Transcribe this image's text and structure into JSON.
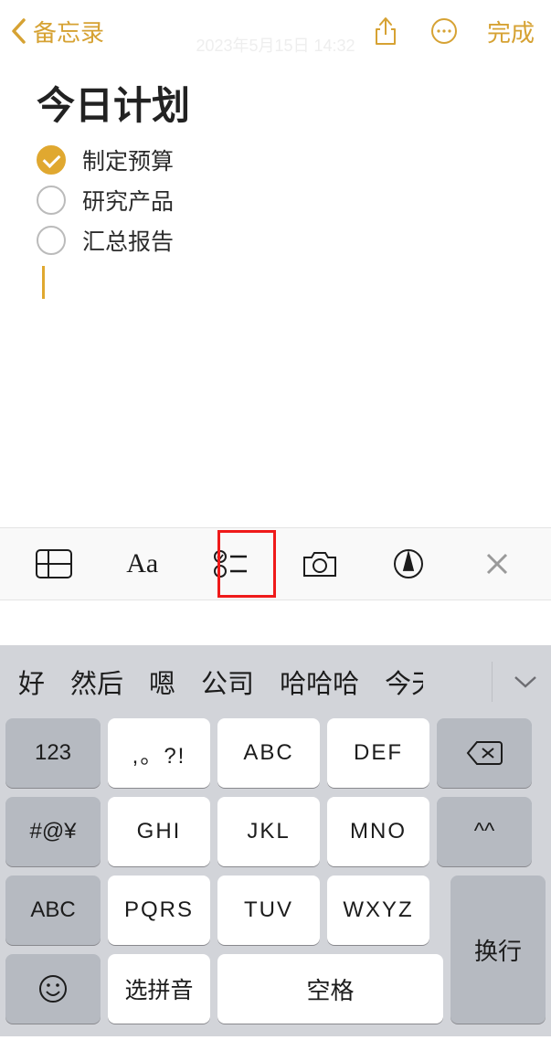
{
  "nav": {
    "back_label": "备忘录",
    "done_label": "完成",
    "timestamp": "2023年5月15日 14:32"
  },
  "note": {
    "title": "今日计划",
    "items": [
      {
        "label": "制定预算",
        "checked": true
      },
      {
        "label": "研究产品",
        "checked": false
      },
      {
        "label": "汇总报告",
        "checked": false
      }
    ]
  },
  "format_bar": {
    "aa_label": "Aa"
  },
  "keyboard": {
    "suggestions": [
      "好",
      "然后",
      "嗯",
      "公司",
      "哈哈哈",
      "今天"
    ],
    "keys": {
      "num": "123",
      "punct": ",。?!",
      "abc": "ABC",
      "def": "DEF",
      "sym": "#@¥",
      "ghi": "GHI",
      "jkl": "JKL",
      "mno": "MNO",
      "face": "^^",
      "shift": "ABC",
      "pqrs": "PQRS",
      "tuv": "TUV",
      "wxyz": "WXYZ",
      "enter": "换行",
      "pinyin": "选拼音",
      "space": "空格"
    }
  }
}
